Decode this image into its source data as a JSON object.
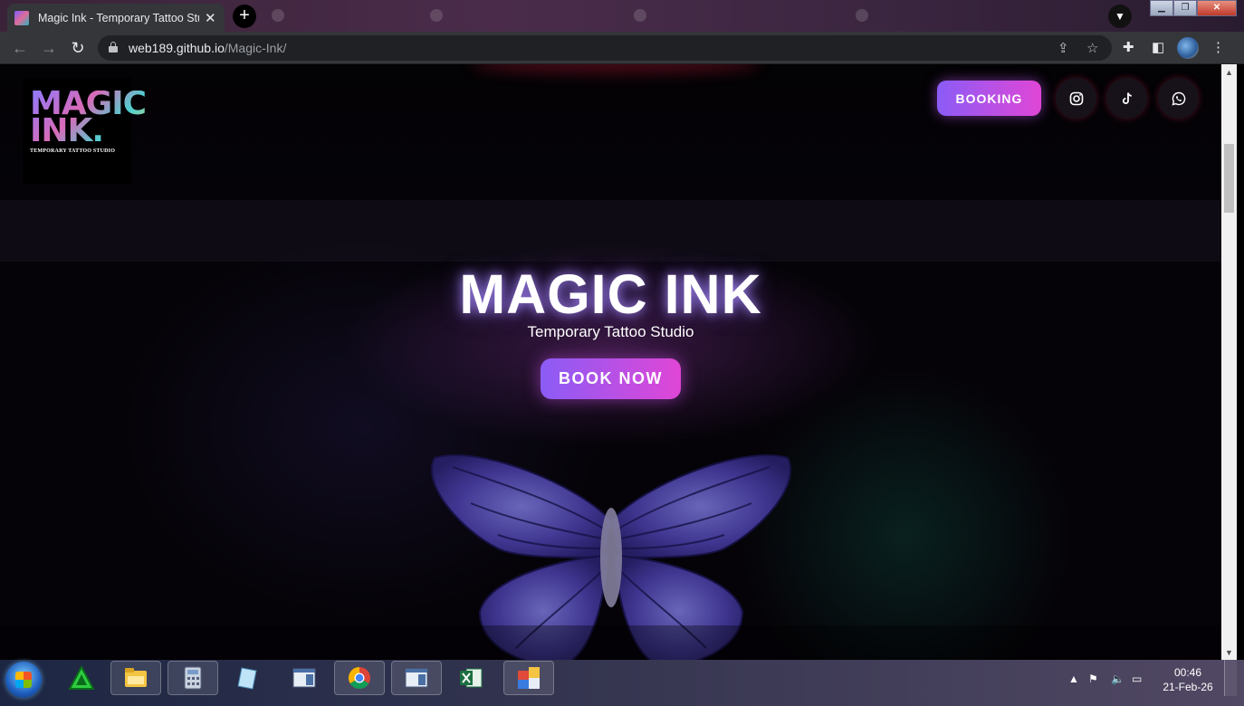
{
  "browser": {
    "active_tab": {
      "title": "Magic Ink - Temporary Tattoo Studio",
      "close": "✕"
    },
    "new_tab_symbol": "+",
    "background_tabs": [
      "",
      "",
      "",
      ""
    ],
    "url_host": "web189.github.io",
    "url_path": "/Magic-Ink/"
  },
  "site": {
    "logo": {
      "word1": "MAGIC",
      "word2": "INK.",
      "subtitle": "TEMPORARY TATTOO STUDIO"
    },
    "nav": {
      "booking_label": "BOOKING",
      "social_icons": [
        "instagram-icon",
        "tiktok-icon",
        "whatsapp-icon"
      ]
    },
    "hero": {
      "title": "MAGIC INK",
      "subtitle": "Temporary Tattoo Studio",
      "cta_label": "BOOK NOW"
    },
    "colors": {
      "accent_start": "#8b5cf6",
      "accent_end": "#e046d6",
      "background": "#050308"
    }
  },
  "taskbar": {
    "apps": [
      "sketchup-icon",
      "explorer-icon",
      "calculator-icon",
      "notepad-icon",
      "app-window-icon",
      "chrome-icon",
      "app-window-icon",
      "excel-icon",
      "app-window-icon"
    ],
    "clock_time": "00:46",
    "clock_date": "21-Feb-26"
  }
}
